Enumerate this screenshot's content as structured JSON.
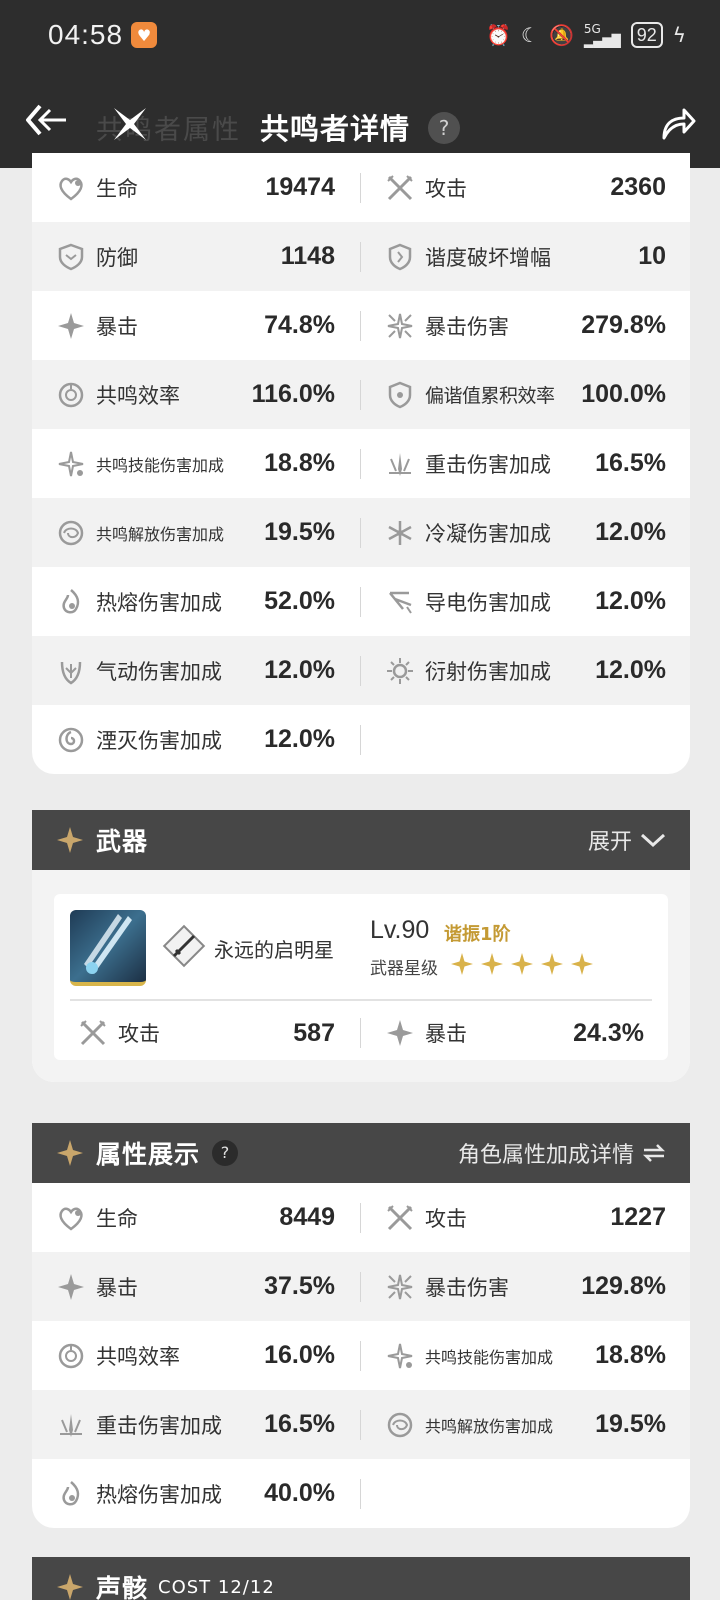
{
  "status_bar": {
    "time": "04:58",
    "network": "5G",
    "battery": "92"
  },
  "header": {
    "title": "共鸣者详情",
    "help": "?",
    "ghost_title": "共鸣者属性"
  },
  "attributes": [
    {
      "left": {
        "icon": "heart-icon",
        "label": "生命",
        "value": "19474"
      },
      "right": {
        "icon": "attack-icon",
        "label": "攻击",
        "value": "2360"
      }
    },
    {
      "left": {
        "icon": "shield-icon",
        "label": "防御",
        "value": "1148"
      },
      "right": {
        "icon": "tune-break-icon",
        "label": "谐度破坏增幅",
        "value": "10"
      }
    },
    {
      "left": {
        "icon": "crit-icon",
        "label": "暴击",
        "value": "74.8%"
      },
      "right": {
        "icon": "crit-damage-icon",
        "label": "暴击伤害",
        "value": "279.8%"
      }
    },
    {
      "left": {
        "icon": "energy-regen-icon",
        "label": "共鸣效率",
        "value": "116.0%"
      },
      "right": {
        "icon": "off-tune-icon",
        "label": "偏谐值累积效率",
        "value": "100.0%"
      }
    },
    {
      "left": {
        "icon": "skill-dmg-icon",
        "label": "共鸣技能伤害加成",
        "value": "18.8%"
      },
      "right": {
        "icon": "heavy-attack-icon",
        "label": "重击伤害加成",
        "value": "16.5%"
      }
    },
    {
      "left": {
        "icon": "liberation-dmg-icon",
        "label": "共鸣解放伤害加成",
        "value": "19.5%"
      },
      "right": {
        "icon": "glacio-icon",
        "label": "冷凝伤害加成",
        "value": "12.0%"
      }
    },
    {
      "left": {
        "icon": "fusion-icon",
        "label": "热熔伤害加成",
        "value": "52.0%"
      },
      "right": {
        "icon": "electro-icon",
        "label": "导电伤害加成",
        "value": "12.0%"
      }
    },
    {
      "left": {
        "icon": "aero-icon",
        "label": "气动伤害加成",
        "value": "12.0%"
      },
      "right": {
        "icon": "spectro-icon",
        "label": "衍射伤害加成",
        "value": "12.0%"
      }
    },
    {
      "left": {
        "icon": "havoc-icon",
        "label": "湮灭伤害加成",
        "value": "12.0%"
      },
      "right": null
    }
  ],
  "weapon": {
    "title": "武器",
    "expand_label": "展开",
    "name": "永远的启明星",
    "level": "Lv.90",
    "rank": "谐振1阶",
    "star_label": "武器星级",
    "stars": 5,
    "stats": [
      {
        "icon": "attack-icon",
        "label": "攻击",
        "value": "587"
      },
      {
        "icon": "crit-icon",
        "label": "暴击",
        "value": "24.3%"
      }
    ]
  },
  "display": {
    "title": "属性展示",
    "help": "?",
    "action_label": "角色属性加成详情",
    "rows": [
      {
        "left": {
          "icon": "heart-icon",
          "label": "生命",
          "value": "8449"
        },
        "right": {
          "icon": "attack-icon",
          "label": "攻击",
          "value": "1227"
        }
      },
      {
        "left": {
          "icon": "crit-icon",
          "label": "暴击",
          "value": "37.5%"
        },
        "right": {
          "icon": "crit-damage-icon",
          "label": "暴击伤害",
          "value": "129.8%"
        }
      },
      {
        "left": {
          "icon": "energy-regen-icon",
          "label": "共鸣效率",
          "value": "16.0%"
        },
        "right": {
          "icon": "skill-dmg-icon",
          "label": "共鸣技能伤害加成",
          "value": "18.8%"
        }
      },
      {
        "left": {
          "icon": "heavy-attack-icon",
          "label": "重击伤害加成",
          "value": "16.5%"
        },
        "right": {
          "icon": "liberation-dmg-icon",
          "label": "共鸣解放伤害加成",
          "value": "19.5%"
        }
      },
      {
        "left": {
          "icon": "fusion-icon",
          "label": "热熔伤害加成",
          "value": "40.0%"
        },
        "right": null
      }
    ]
  },
  "echo": {
    "title": "声骸",
    "cost": "COST 12/12"
  },
  "colors": {
    "header_bg": "#2d2d2d",
    "card_head_bg": "#474747",
    "gold": "#c49a34",
    "alt_row": "#f2f2f2"
  }
}
